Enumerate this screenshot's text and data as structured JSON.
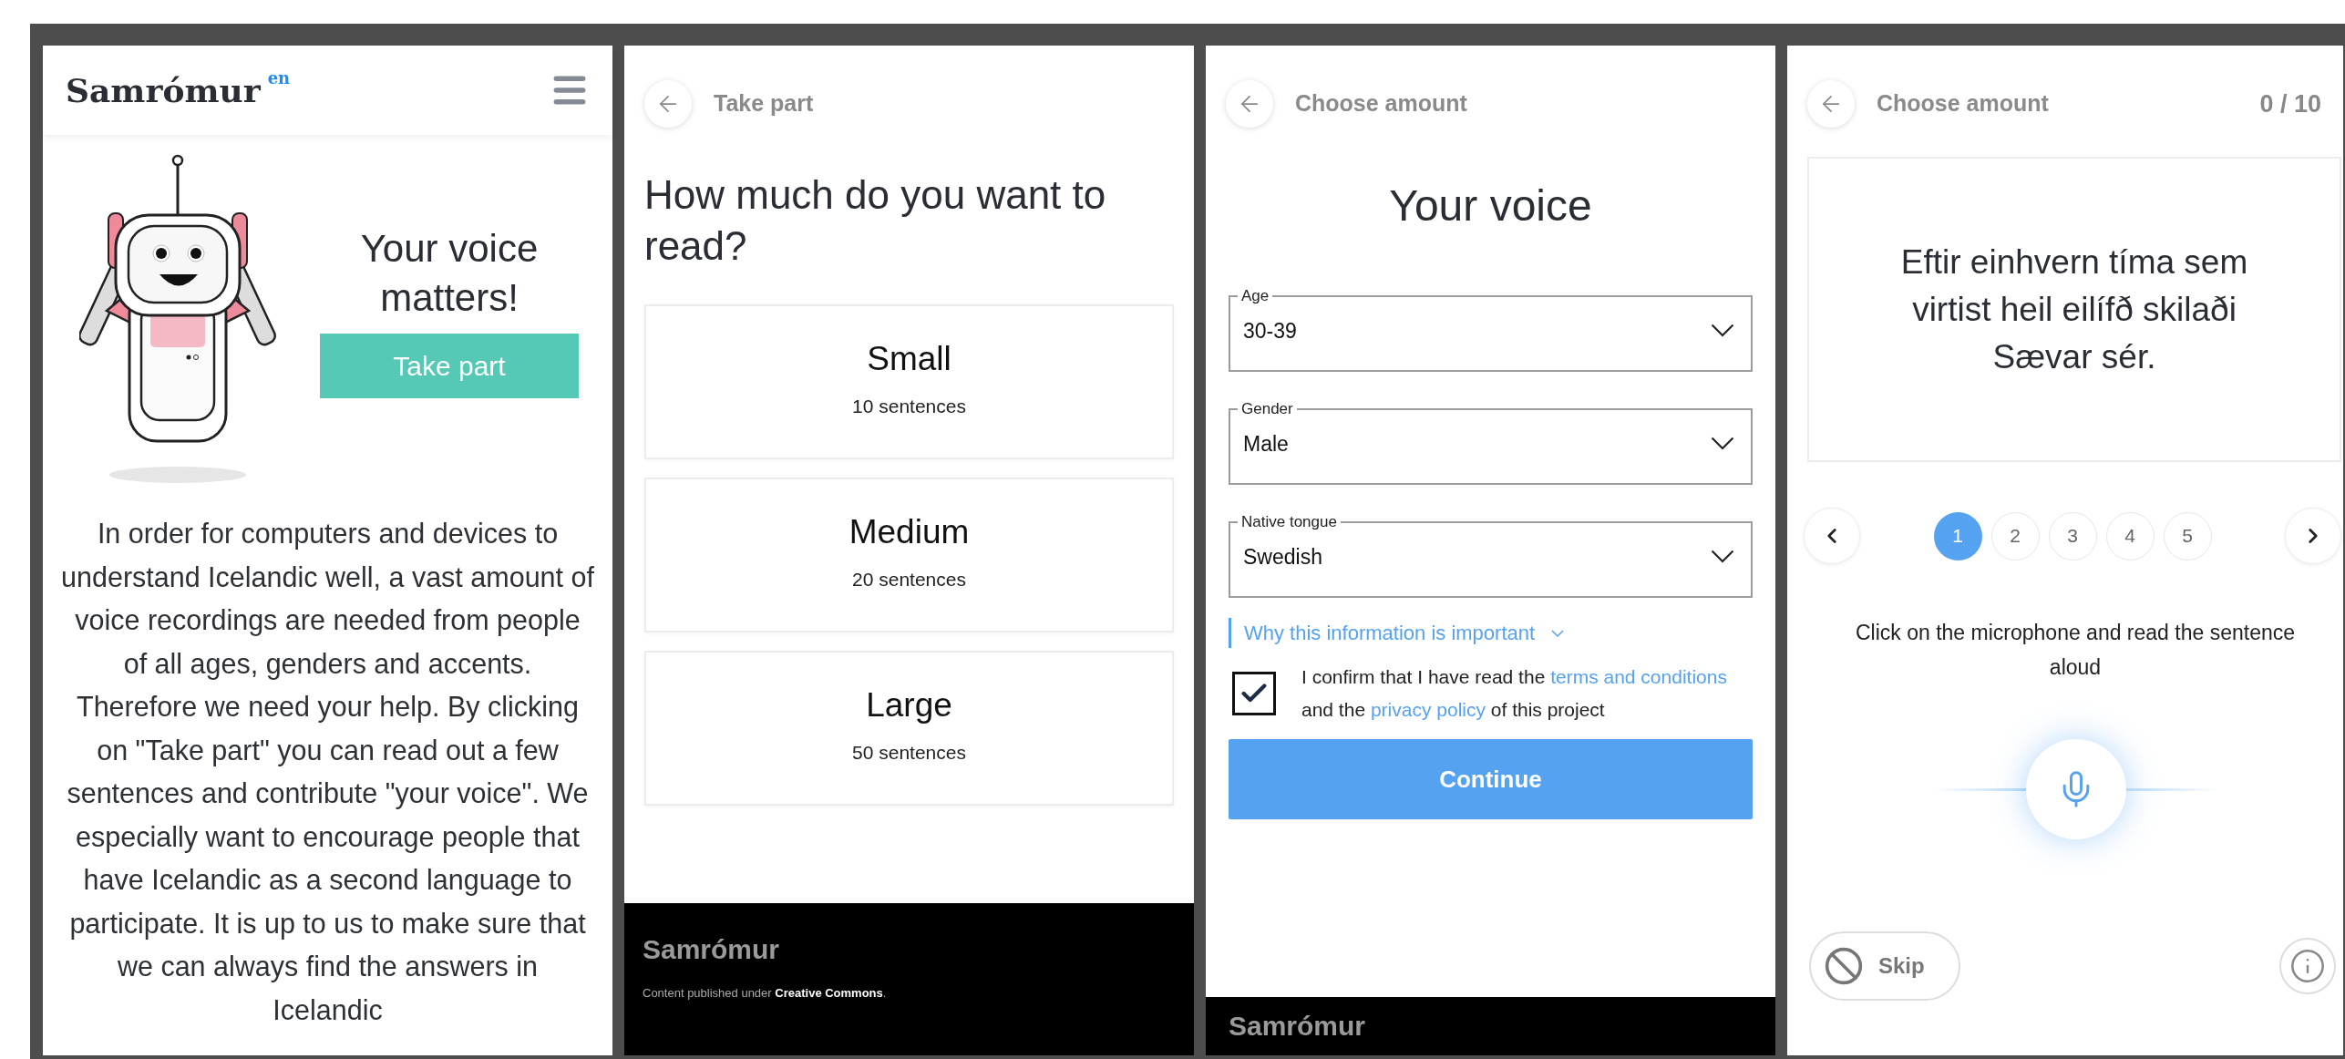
{
  "home": {
    "logo": "Samrómur",
    "language_badge": "en",
    "heading": "Your voice matters!",
    "button": "Take part",
    "body": "In order for computers and devices to understand Icelandic well, a vast amount of voice recordings are needed from people of all ages, genders and accents. Therefore we need your help. By clicking on \"Take part\" you can read out a few sentences and contribute \"your voice\". We especially want to encourage people that have Icelandic as a second language to participate. It is up to us to make sure that we can always find the answers in Icelandic"
  },
  "amount": {
    "back_label": "Take part",
    "heading": "How much do you want to read?",
    "options": [
      {
        "title": "Small",
        "subtitle": "10 sentences"
      },
      {
        "title": "Medium",
        "subtitle": "20 sentences"
      },
      {
        "title": "Large",
        "subtitle": "50 sentences"
      }
    ],
    "footer": {
      "brand": "Samrómur",
      "note": "Content published under",
      "link": "Creative Commons",
      "end": "."
    }
  },
  "details": {
    "back_label": "Choose amount",
    "heading": "Your voice",
    "fields": [
      {
        "label": "Age",
        "value": "30-39"
      },
      {
        "label": "Gender",
        "value": "Male"
      },
      {
        "label": "Native tongue",
        "value": "Swedish"
      }
    ],
    "info_link": "Why this information is important",
    "consent": {
      "checked": true,
      "text_1": "I confirm that I have read the",
      "link_1": "terms and conditions",
      "text_2": "and the",
      "link_2": "privacy policy",
      "text_3": "of this project"
    },
    "button": "Continue",
    "footer_brand": "Samrómur"
  },
  "recording": {
    "back_label": "Choose amount",
    "progress": "0 / 10",
    "sentence": "Eftir einhvern tíma sem virtist heil eilífð skilaði Sævar sér.",
    "pages": [
      {
        "label": "1",
        "selected": true
      },
      {
        "label": "2",
        "selected": false
      },
      {
        "label": "3",
        "selected": false
      },
      {
        "label": "4",
        "selected": false
      },
      {
        "label": "5",
        "selected": false
      }
    ],
    "instruction": "Click on the microphone and read the sentence aloud",
    "skip": "Skip"
  }
}
